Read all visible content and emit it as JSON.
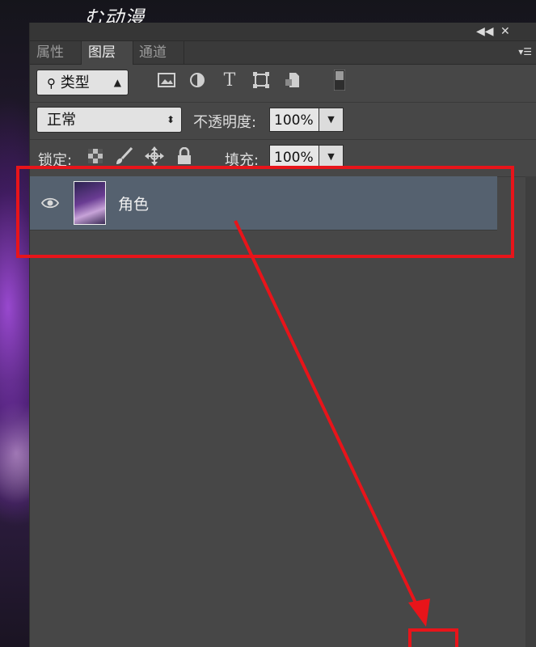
{
  "background": {
    "logo_text": "む动漫"
  },
  "panel": {
    "titlebar": {
      "collapse_icon": "double-chevron-left",
      "close_label": "✕",
      "collapse_label": "◀◀"
    },
    "tabs": [
      {
        "label": "属性",
        "active": false
      },
      {
        "label": "图层",
        "active": true
      },
      {
        "label": "通道",
        "active": false
      }
    ],
    "menu_icon": "panel-menu-icon",
    "filter": {
      "kind_label": "类型",
      "icons": [
        "image-filter-icon",
        "adjustment-filter-icon",
        "text-filter-icon",
        "shape-filter-icon",
        "smart-object-filter-icon"
      ],
      "toggle_icon": "filter-toggle-icon"
    },
    "blend": {
      "mode": "正常",
      "opacity_label": "不透明度:",
      "opacity_value": "100%"
    },
    "lock": {
      "label": "锁定:",
      "icons": [
        "lock-transparent-icon",
        "lock-image-icon",
        "lock-position-icon",
        "lock-all-icon"
      ],
      "fill_label": "填充:",
      "fill_value": "100%"
    },
    "layers": [
      {
        "name": "角色",
        "visible": true,
        "selected": true
      }
    ]
  },
  "annotation": {
    "color": "#e8141a"
  }
}
